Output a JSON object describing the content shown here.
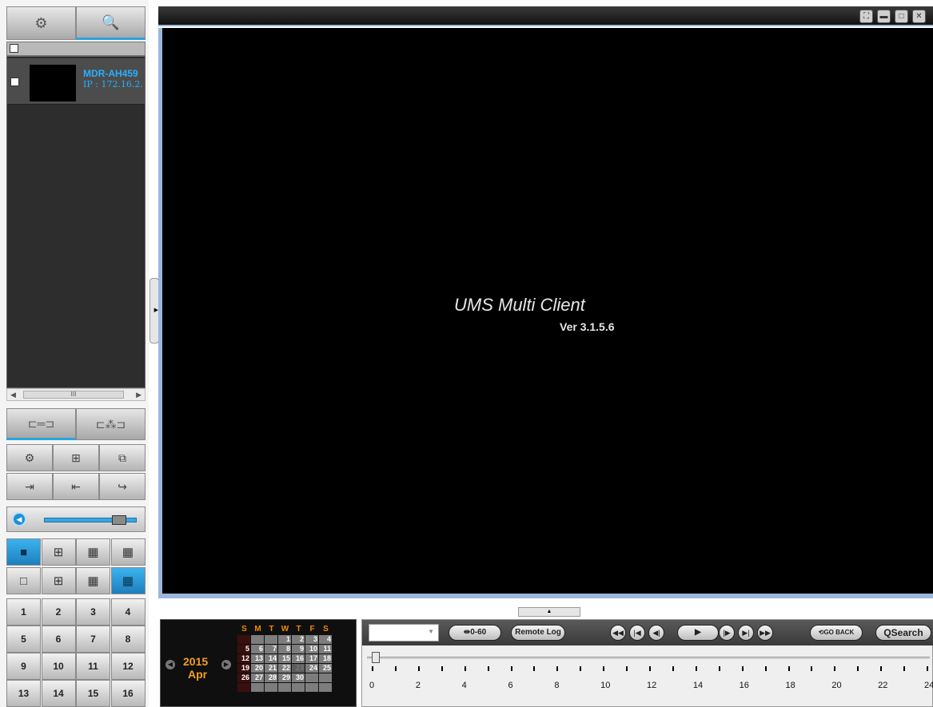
{
  "sidebar": {
    "tabs": [
      {
        "icon": "gear-icon",
        "glyph": "⚙"
      },
      {
        "icon": "search-icon",
        "glyph": "🔍"
      }
    ],
    "device": {
      "name": "MDR-AH459",
      "ip": "IP : 172.16.2."
    },
    "scroll_grip": "III",
    "connect_tabs": [
      {
        "icon": "single-connect-icon",
        "glyph": "⊏═⊐"
      },
      {
        "icon": "multi-connect-icon",
        "glyph": "⊏⁂⊐"
      }
    ],
    "tools": [
      {
        "icon": "device-settings-icon",
        "glyph": "⚙"
      },
      {
        "icon": "add-device-icon",
        "glyph": "⊞"
      },
      {
        "icon": "group-icon",
        "glyph": "⧉"
      },
      {
        "icon": "export-icon",
        "glyph": "⇥"
      },
      {
        "icon": "import-icon",
        "glyph": "⇤"
      },
      {
        "icon": "redirect-icon",
        "glyph": "↪"
      }
    ],
    "volume_level": 0.8,
    "layouts": [
      {
        "icon": "layout-1-icon",
        "glyph": "■",
        "selected": true
      },
      {
        "icon": "layout-4-icon",
        "glyph": "⊞",
        "selected": false
      },
      {
        "icon": "layout-9-icon",
        "glyph": "▦",
        "selected": false
      },
      {
        "icon": "layout-16-icon",
        "glyph": "▦",
        "selected": false
      },
      {
        "icon": "layout-1-outline-icon",
        "glyph": "□",
        "selected": false
      },
      {
        "icon": "layout-4-outline-icon",
        "glyph": "⊞",
        "selected": false
      },
      {
        "icon": "layout-9-outline-icon",
        "glyph": "▦",
        "selected": false
      },
      {
        "icon": "layout-16-outline-icon",
        "glyph": "▦",
        "selected": true
      }
    ],
    "channels": [
      "1",
      "2",
      "3",
      "4",
      "5",
      "6",
      "7",
      "8",
      "9",
      "10",
      "11",
      "12",
      "13",
      "14",
      "15",
      "16"
    ]
  },
  "viewer": {
    "app_name": "UMS Multi Client",
    "version": "Ver 3.1.5.6",
    "window_buttons": [
      {
        "icon": "fullscreen-icon",
        "glyph": "⛶"
      },
      {
        "icon": "minimize-icon",
        "glyph": "▬"
      },
      {
        "icon": "maximize-icon",
        "glyph": "□"
      },
      {
        "icon": "close-icon",
        "glyph": "✕"
      }
    ]
  },
  "calendar": {
    "year": "2015",
    "month": "Apr",
    "weekdays": [
      "S",
      "M",
      "T",
      "W",
      "T",
      "F",
      "S"
    ],
    "weeks": [
      [
        "",
        "",
        "",
        "1",
        "2",
        "3",
        "4"
      ],
      [
        "5",
        "6",
        "7",
        "8",
        "9",
        "10",
        "11"
      ],
      [
        "12",
        "13",
        "14",
        "15",
        "16",
        "17",
        "18"
      ],
      [
        "19",
        "20",
        "21",
        "22",
        "23",
        "24",
        "25"
      ],
      [
        "26",
        "27",
        "28",
        "29",
        "30",
        "",
        ""
      ],
      [
        "",
        "",
        "",
        "",
        "",
        "",
        ""
      ]
    ],
    "today": "23"
  },
  "playback": {
    "range_label": "0-60",
    "remote_log_label": "Remote Log",
    "transport": [
      {
        "icon": "fast-rewind-icon",
        "glyph": "◀◀"
      },
      {
        "icon": "skip-back-icon",
        "glyph": "|◀"
      },
      {
        "icon": "step-back-icon",
        "glyph": "◀|"
      },
      {
        "icon": "play-icon",
        "glyph": "▶"
      },
      {
        "icon": "step-forward-icon",
        "glyph": "|▶"
      },
      {
        "icon": "skip-forward-icon",
        "glyph": "▶|"
      },
      {
        "icon": "fast-forward-icon",
        "glyph": "▶▶"
      }
    ],
    "go_back_label": "GO BACK",
    "search_label": "QSearch",
    "hours": [
      "0",
      "2",
      "4",
      "6",
      "8",
      "10",
      "12",
      "14",
      "16",
      "18",
      "20",
      "22",
      "24"
    ]
  }
}
